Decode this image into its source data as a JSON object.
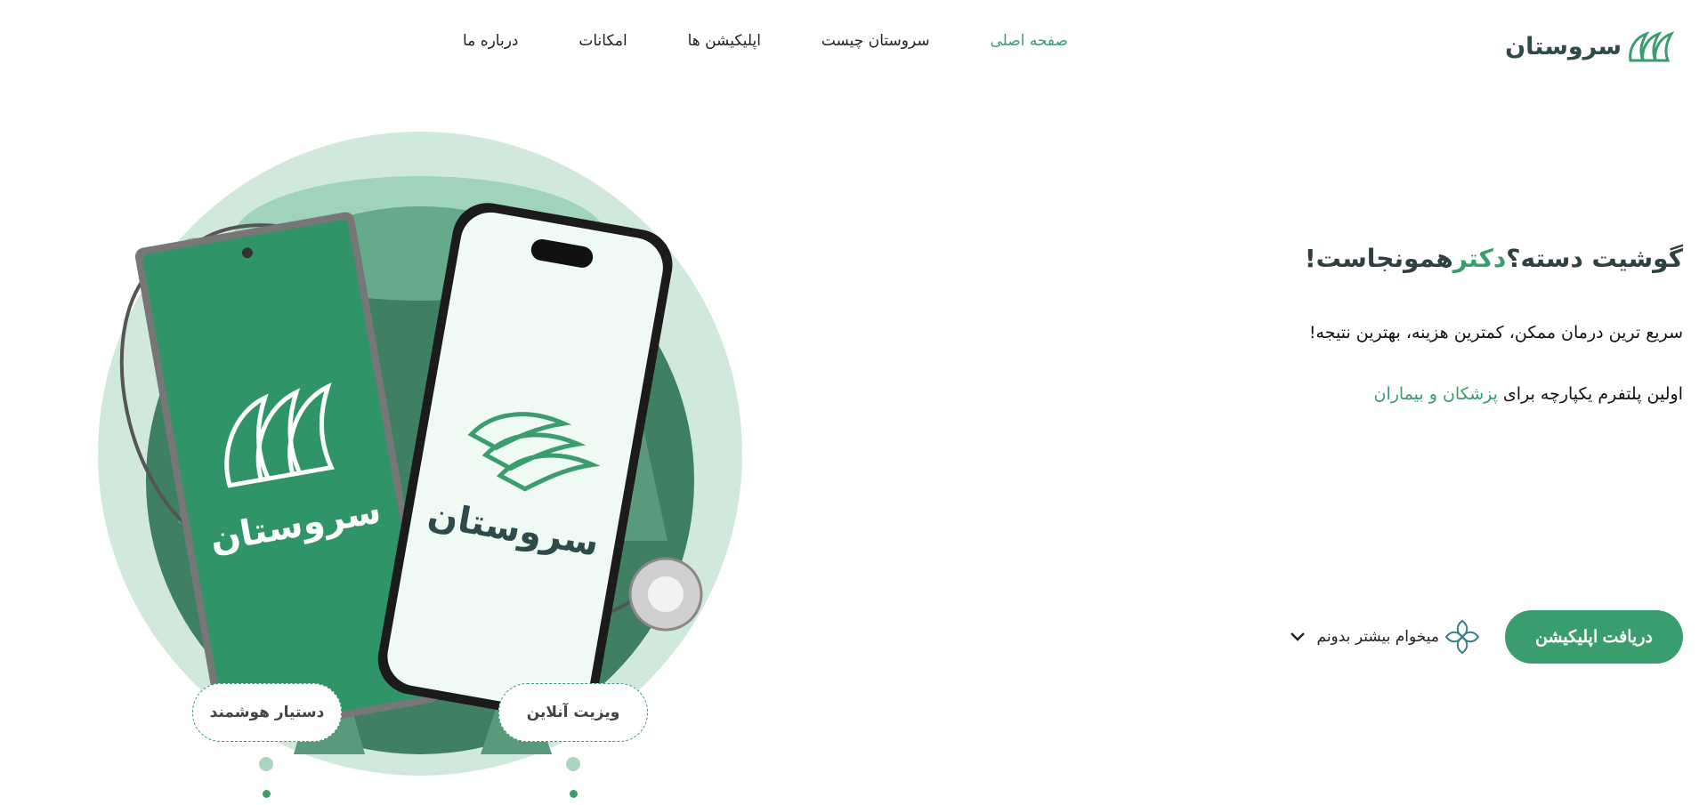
{
  "header": {
    "logo_text": "سروستان",
    "nav": [
      {
        "label": "صفحه اصلی",
        "active": true
      },
      {
        "label": "سروستان چیست"
      },
      {
        "label": "اپلیکیشن ها"
      },
      {
        "label": "امکانات"
      },
      {
        "label": "درباره ما"
      }
    ]
  },
  "hero": {
    "title_part1": "گوشیت دسته؟",
    "title_accent": "دکتر",
    "title_part2": "همونجاست!",
    "subtitle": "سریع ترین درمان ممکن، کمترین هزینه، بهترین نتیجه!",
    "line_prefix": "اولین پلتفرم یکپارچه برای ",
    "line_accent": "پزشکان و بیماران"
  },
  "cta": {
    "primary_label": "دریافت اپلیکیشن",
    "secondary_label": "میخوام بیشتر بدونم"
  },
  "illustration": {
    "phone_left_brand": "سروستان",
    "phone_right_brand": "سروستان",
    "chip_left": "دستیار هوشمند",
    "chip_right": "ویزیت آنلاین"
  },
  "colors": {
    "brand": "#3a9d6d",
    "dark_text": "#2f4040",
    "light_green": "#d1e9dd",
    "phone_dark": "#2f9466",
    "forest": "#4a8a6a"
  },
  "icons": [
    "leaf-logo-icon",
    "chevron-down-icon",
    "flower-icon",
    "stethoscope-icon"
  ]
}
